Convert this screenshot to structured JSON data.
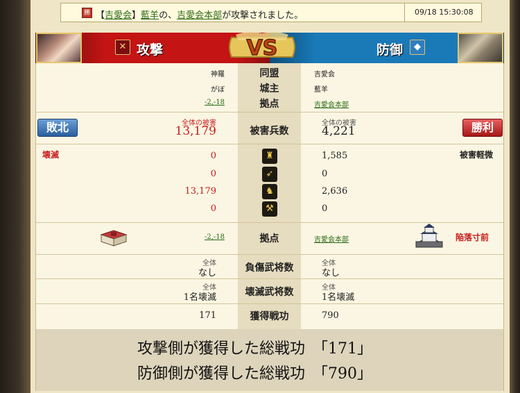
{
  "notice": {
    "icon_label": "勝",
    "parts": {
      "p1": "【",
      "alliance": "吉愛会",
      "p2": "】",
      "lord": "藍羊",
      "p3": "の、",
      "base": "吉愛会本部",
      "p4": "が攻撃されました。"
    },
    "timestamp": "09/18 15:30:08"
  },
  "header": {
    "attack_label": "攻撃",
    "defense_label": "防御",
    "vs": "VS"
  },
  "rows": {
    "alliance": {
      "label": "同盟",
      "attacker": "神羅",
      "defender": "吉愛会"
    },
    "lord": {
      "label": "城主",
      "attacker": "がぼ",
      "defender": "藍羊"
    },
    "base": {
      "label": "拠点",
      "attacker": "-2,-18",
      "defender": "吉愛会本部"
    }
  },
  "damage": {
    "label": "被害兵数",
    "attacker_caption": "全体の被害",
    "attacker_total": "13,179",
    "defender_caption": "全体の被害",
    "defender_total": "4,221",
    "attacker_result": "敗北",
    "defender_result": "勝利",
    "attacker_status": "壊滅",
    "defender_status": "被害軽微"
  },
  "units": [
    {
      "icon": "spear-icon",
      "attacker": "0",
      "defender": "1,585"
    },
    {
      "icon": "bow-icon",
      "attacker": "0",
      "defender": "0"
    },
    {
      "icon": "horse-icon",
      "attacker": "13,179",
      "defender": "2,636"
    },
    {
      "icon": "siege-icon",
      "attacker": "0",
      "defender": "0"
    }
  ],
  "base_row": {
    "label": "拠点",
    "attacker": "-2,-18",
    "defender": "吉愛会本部",
    "defender_status": "陥落寸前"
  },
  "injured": {
    "label": "負傷武将数",
    "attacker_caption": "全体",
    "attacker": "なし",
    "defender_caption": "全体",
    "defender": "なし"
  },
  "destroyed": {
    "label": "壊滅武将数",
    "attacker_caption": "全体",
    "attacker": "1名壊滅",
    "defender_caption": "全体",
    "defender": "1名壊滅"
  },
  "merit": {
    "label": "獲得戦功",
    "attacker": "171",
    "defender": "790"
  },
  "summary": {
    "attack_line": "攻撃側が獲得した総戦功　「171」",
    "defense_line": "防御側が獲得した総戦功　「790」"
  },
  "colors": {
    "attack_red": "#c41414",
    "defense_blue": "#1a7ab8",
    "loss_red": "#c81e1e",
    "link_green": "#2a6a14"
  }
}
